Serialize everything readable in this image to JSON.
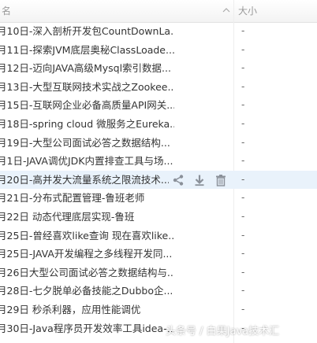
{
  "header": {
    "name_label": "名",
    "size_label": "大小"
  },
  "files": [
    {
      "name": "月10日-深入剖析开发包CountDownLa...",
      "size": "-"
    },
    {
      "name": "月11日-探索JVM底层奥秘ClassLoade...",
      "size": "-"
    },
    {
      "name": "月12日-迈向JAVA高级Mysql索引数据...",
      "size": "-"
    },
    {
      "name": "月13日-大型互联网技术实战之Zookee...",
      "size": "-"
    },
    {
      "name": "月15日-互联网企业必备高质量API网关...",
      "size": "-"
    },
    {
      "name": "月18日-spring cloud 微服务之Eureka...",
      "size": "-"
    },
    {
      "name": "月19日-大型公司面试必答之数据结构...",
      "size": "-"
    },
    {
      "name": "月1日-JAVA调优JDK内置排查工具与场...",
      "size": "-"
    },
    {
      "name": "月20日-高并发大流量系统之限流技术...",
      "size": "-"
    },
    {
      "name": "月21日-分布式配置管理-鲁班老师",
      "size": "-"
    },
    {
      "name": "月22日 动态代理底层实现-鲁班",
      "size": "-"
    },
    {
      "name": "月25日-曾经喜欢like查询 现在喜欢like...",
      "size": "-"
    },
    {
      "name": "月25日-JAVA开发编程之多线程开发同...",
      "size": "-"
    },
    {
      "name": "月26日大型公司面试必答之数据结构与...",
      "size": "-"
    },
    {
      "name": "月28日-七夕脱单必备技能之Dubbo企...",
      "size": "-"
    },
    {
      "name": "月29日 秒杀利器，应用性能调优",
      "size": "-"
    },
    {
      "name": "月30日-Java程序员开发效率工具idea-...",
      "size": "-"
    }
  ],
  "hover_row_index": 8,
  "row_actions": [
    "share-icon",
    "download-icon",
    "delete-icon"
  ],
  "watermark": "头条号 / 白果Java技术汇",
  "colors": {
    "hover": "#e9f2fb",
    "text": "#333333",
    "header_text": "#9a9a9a",
    "icon": "#8a9099"
  }
}
